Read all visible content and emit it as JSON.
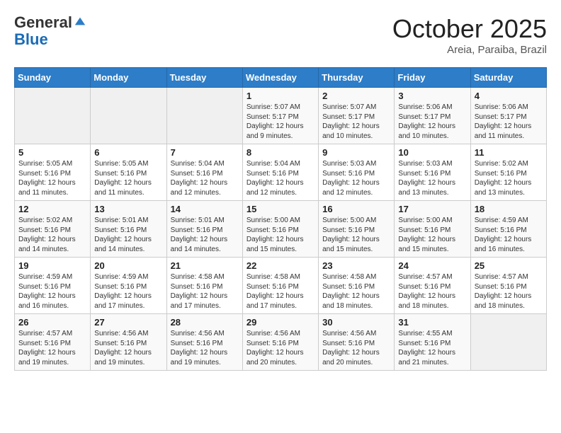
{
  "header": {
    "logo_line1": "General",
    "logo_line2": "Blue",
    "month": "October 2025",
    "location": "Areia, Paraiba, Brazil"
  },
  "days_of_week": [
    "Sunday",
    "Monday",
    "Tuesday",
    "Wednesday",
    "Thursday",
    "Friday",
    "Saturday"
  ],
  "weeks": [
    [
      {
        "day": "",
        "text": ""
      },
      {
        "day": "",
        "text": ""
      },
      {
        "day": "",
        "text": ""
      },
      {
        "day": "1",
        "text": "Sunrise: 5:07 AM\nSunset: 5:17 PM\nDaylight: 12 hours and 9 minutes."
      },
      {
        "day": "2",
        "text": "Sunrise: 5:07 AM\nSunset: 5:17 PM\nDaylight: 12 hours and 10 minutes."
      },
      {
        "day": "3",
        "text": "Sunrise: 5:06 AM\nSunset: 5:17 PM\nDaylight: 12 hours and 10 minutes."
      },
      {
        "day": "4",
        "text": "Sunrise: 5:06 AM\nSunset: 5:17 PM\nDaylight: 12 hours and 11 minutes."
      }
    ],
    [
      {
        "day": "5",
        "text": "Sunrise: 5:05 AM\nSunset: 5:16 PM\nDaylight: 12 hours and 11 minutes."
      },
      {
        "day": "6",
        "text": "Sunrise: 5:05 AM\nSunset: 5:16 PM\nDaylight: 12 hours and 11 minutes."
      },
      {
        "day": "7",
        "text": "Sunrise: 5:04 AM\nSunset: 5:16 PM\nDaylight: 12 hours and 12 minutes."
      },
      {
        "day": "8",
        "text": "Sunrise: 5:04 AM\nSunset: 5:16 PM\nDaylight: 12 hours and 12 minutes."
      },
      {
        "day": "9",
        "text": "Sunrise: 5:03 AM\nSunset: 5:16 PM\nDaylight: 12 hours and 12 minutes."
      },
      {
        "day": "10",
        "text": "Sunrise: 5:03 AM\nSunset: 5:16 PM\nDaylight: 12 hours and 13 minutes."
      },
      {
        "day": "11",
        "text": "Sunrise: 5:02 AM\nSunset: 5:16 PM\nDaylight: 12 hours and 13 minutes."
      }
    ],
    [
      {
        "day": "12",
        "text": "Sunrise: 5:02 AM\nSunset: 5:16 PM\nDaylight: 12 hours and 14 minutes."
      },
      {
        "day": "13",
        "text": "Sunrise: 5:01 AM\nSunset: 5:16 PM\nDaylight: 12 hours and 14 minutes."
      },
      {
        "day": "14",
        "text": "Sunrise: 5:01 AM\nSunset: 5:16 PM\nDaylight: 12 hours and 14 minutes."
      },
      {
        "day": "15",
        "text": "Sunrise: 5:00 AM\nSunset: 5:16 PM\nDaylight: 12 hours and 15 minutes."
      },
      {
        "day": "16",
        "text": "Sunrise: 5:00 AM\nSunset: 5:16 PM\nDaylight: 12 hours and 15 minutes."
      },
      {
        "day": "17",
        "text": "Sunrise: 5:00 AM\nSunset: 5:16 PM\nDaylight: 12 hours and 15 minutes."
      },
      {
        "day": "18",
        "text": "Sunrise: 4:59 AM\nSunset: 5:16 PM\nDaylight: 12 hours and 16 minutes."
      }
    ],
    [
      {
        "day": "19",
        "text": "Sunrise: 4:59 AM\nSunset: 5:16 PM\nDaylight: 12 hours and 16 minutes."
      },
      {
        "day": "20",
        "text": "Sunrise: 4:59 AM\nSunset: 5:16 PM\nDaylight: 12 hours and 17 minutes."
      },
      {
        "day": "21",
        "text": "Sunrise: 4:58 AM\nSunset: 5:16 PM\nDaylight: 12 hours and 17 minutes."
      },
      {
        "day": "22",
        "text": "Sunrise: 4:58 AM\nSunset: 5:16 PM\nDaylight: 12 hours and 17 minutes."
      },
      {
        "day": "23",
        "text": "Sunrise: 4:58 AM\nSunset: 5:16 PM\nDaylight: 12 hours and 18 minutes."
      },
      {
        "day": "24",
        "text": "Sunrise: 4:57 AM\nSunset: 5:16 PM\nDaylight: 12 hours and 18 minutes."
      },
      {
        "day": "25",
        "text": "Sunrise: 4:57 AM\nSunset: 5:16 PM\nDaylight: 12 hours and 18 minutes."
      }
    ],
    [
      {
        "day": "26",
        "text": "Sunrise: 4:57 AM\nSunset: 5:16 PM\nDaylight: 12 hours and 19 minutes."
      },
      {
        "day": "27",
        "text": "Sunrise: 4:56 AM\nSunset: 5:16 PM\nDaylight: 12 hours and 19 minutes."
      },
      {
        "day": "28",
        "text": "Sunrise: 4:56 AM\nSunset: 5:16 PM\nDaylight: 12 hours and 19 minutes."
      },
      {
        "day": "29",
        "text": "Sunrise: 4:56 AM\nSunset: 5:16 PM\nDaylight: 12 hours and 20 minutes."
      },
      {
        "day": "30",
        "text": "Sunrise: 4:56 AM\nSunset: 5:16 PM\nDaylight: 12 hours and 20 minutes."
      },
      {
        "day": "31",
        "text": "Sunrise: 4:55 AM\nSunset: 5:16 PM\nDaylight: 12 hours and 21 minutes."
      },
      {
        "day": "",
        "text": ""
      }
    ]
  ]
}
